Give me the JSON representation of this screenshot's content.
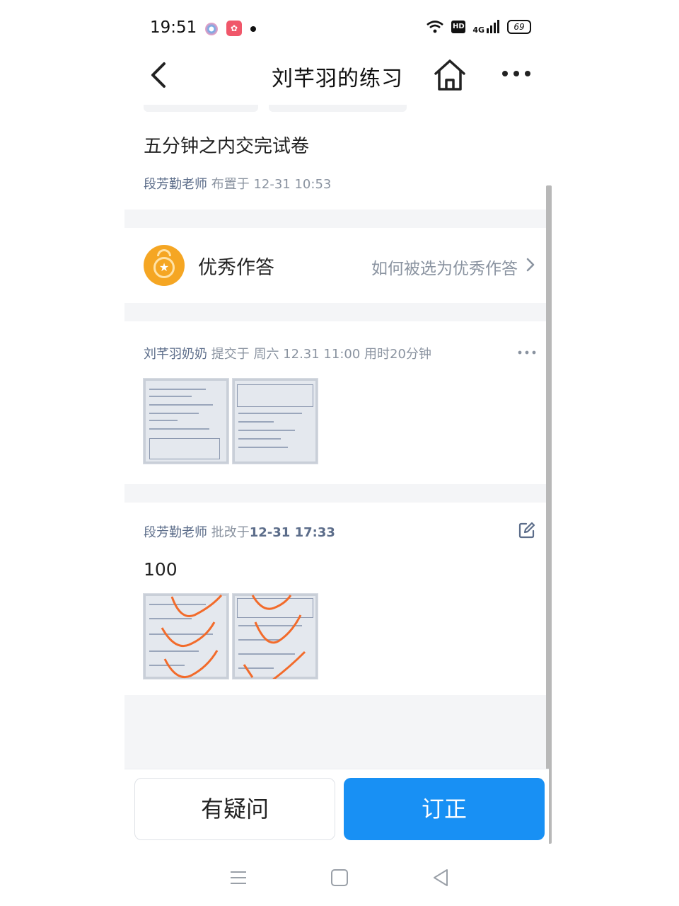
{
  "status_bar": {
    "time": "19:51",
    "hd_label": "HD",
    "network_label": "4G",
    "battery": "69"
  },
  "header": {
    "title": "刘芊羽的练习"
  },
  "assignment": {
    "title": "五分钟之内交完试卷",
    "teacher": "段芳勤老师",
    "assigned_text": "布置于 12-31 10:53"
  },
  "excellent": {
    "label": "优秀作答",
    "link": "如何被选为优秀作答"
  },
  "submission": {
    "submitter": "刘芊羽奶奶",
    "submitted_text": "提交于  周六 12.31 11:00  用时20分钟"
  },
  "grading": {
    "teacher": "段芳勤老师",
    "graded_prefix": "批改于",
    "graded_time": "12-31 17:33",
    "score": "100"
  },
  "actions": {
    "question_label": "有疑问",
    "correct_label": "订正"
  },
  "colors": {
    "accent": "#1890f4",
    "medal": "#f5a623",
    "correction_mark": "#f26b2b"
  }
}
